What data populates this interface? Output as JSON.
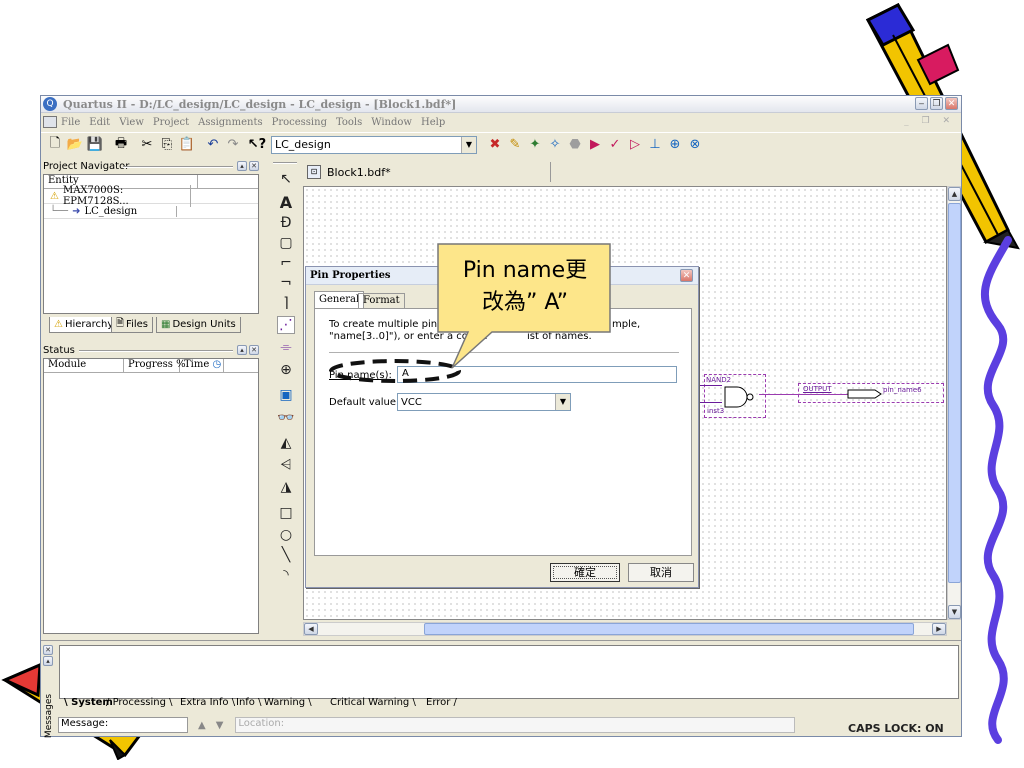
{
  "title_bar": {
    "title": "Quartus II - D:/LC_design/LC_design - LC_design - [Block1.bdf*]"
  },
  "menu": [
    "File",
    "Edit",
    "View",
    "Project",
    "Assignments",
    "Processing",
    "Tools",
    "Window",
    "Help"
  ],
  "toolbar": {
    "project_combo_value": "LC_design"
  },
  "navigator": {
    "title": "Project Navigator",
    "header": "Entity",
    "rows": [
      "MAX7000S: EPM7128S...",
      "LC_design"
    ],
    "tabs": [
      "Hierarchy",
      "Files",
      "Design Units"
    ]
  },
  "status": {
    "title": "Status",
    "columns": [
      "Module",
      "Progress %",
      "Time"
    ]
  },
  "document": {
    "tab_label": "Block1.bdf*"
  },
  "dialog": {
    "title": "Pin Properties",
    "tabs": [
      "General",
      "Format"
    ],
    "description_line1": "To create multiple pins,",
    "description_line1_end": "mple,",
    "description_line2": "\"name[3..0]\"), or enter a comm",
    "description_line2_end": "ist of names.",
    "pin_name_label": "Pin name(s):",
    "pin_name_value": "A",
    "default_value_label": "Default value:",
    "default_value": "VCC",
    "ok_label": "確定",
    "cancel_label": "取消"
  },
  "callout": {
    "line1": "Pin name更",
    "line2": "改為” A”"
  },
  "schematic": {
    "gate_label": "NAND2",
    "inst_label": "inst3",
    "output_label": "OUTPUT",
    "pin_label": "pin_name6"
  },
  "messages": {
    "side_label": "Messages",
    "tabs": [
      "System",
      "Processing",
      "Extra Info",
      "Info",
      "Warning",
      "Critical Warning",
      "Error"
    ],
    "message_label": "Message:",
    "location_placeholder": "Location:",
    "caps_lock": "CAPS LOCK: ON"
  },
  "colors": {
    "callout_fill": "#fde68a",
    "dialog_title": "#e6edf7",
    "pin_wire": "#9b3bb0",
    "squiggle": "#5b3fe0"
  }
}
